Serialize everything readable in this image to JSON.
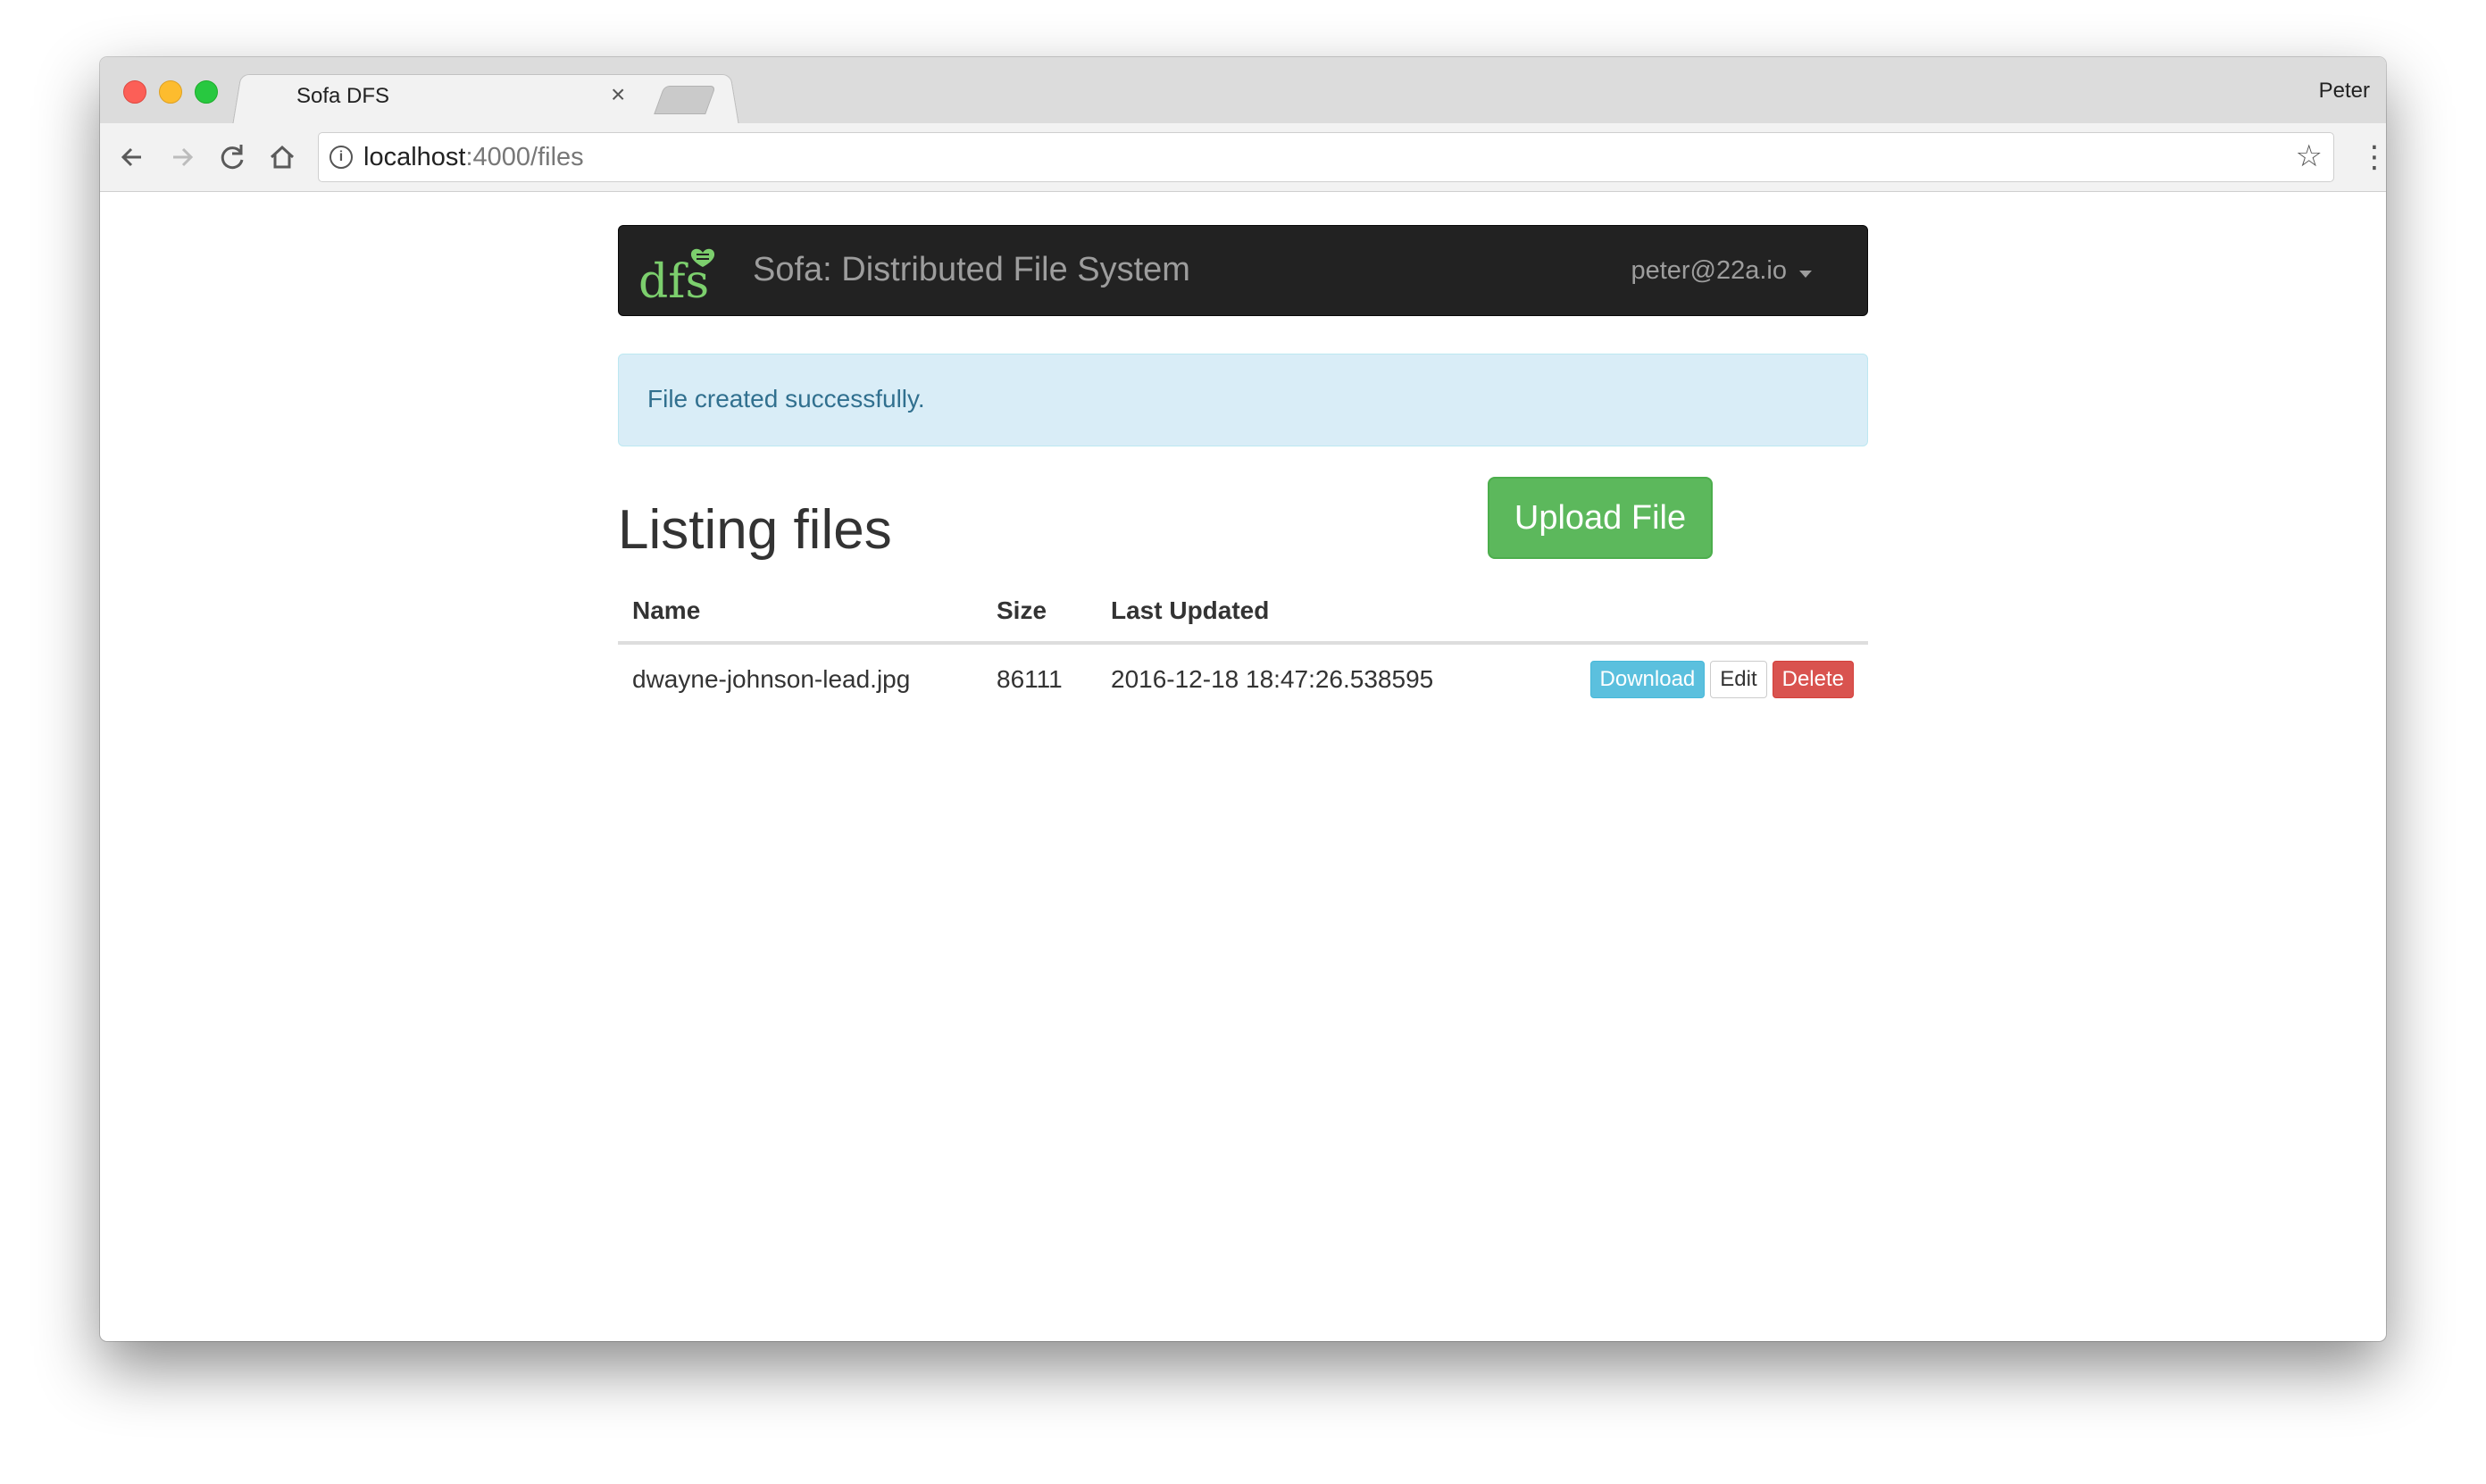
{
  "browser": {
    "tab_title": "Sofa DFS",
    "tab_close": "×",
    "profile_name": "Peter",
    "url_host": "localhost",
    "url_path": ":4000/files"
  },
  "navbar": {
    "logo_text": "dfs",
    "brand": "Sofa: Distributed File System",
    "user_email": "peter@22a.io"
  },
  "alert": {
    "message": "File created successfully."
  },
  "main": {
    "title": "Listing files",
    "upload_label": "Upload File"
  },
  "table": {
    "headers": [
      "Name",
      "Size",
      "Last Updated",
      ""
    ],
    "rows": [
      {
        "name": "dwayne-johnson-lead.jpg",
        "size": "86111",
        "updated": "2016-12-18 18:47:26.538595",
        "download_label": "Download",
        "edit_label": "Edit",
        "delete_label": "Delete"
      }
    ]
  },
  "icons": {
    "back": "arrow-left-icon",
    "forward": "arrow-right-icon",
    "reload": "reload-icon",
    "home": "home-icon",
    "info": "info-icon",
    "bookmark": "star-icon",
    "menu": "kebab-menu-icon"
  },
  "colors": {
    "navbar_bg": "#222222",
    "logo_green": "#7ccf6d",
    "alert_bg": "#d9edf7",
    "upload_green": "#5cb85c",
    "download_blue": "#5bc0de",
    "delete_red": "#d9534f"
  }
}
